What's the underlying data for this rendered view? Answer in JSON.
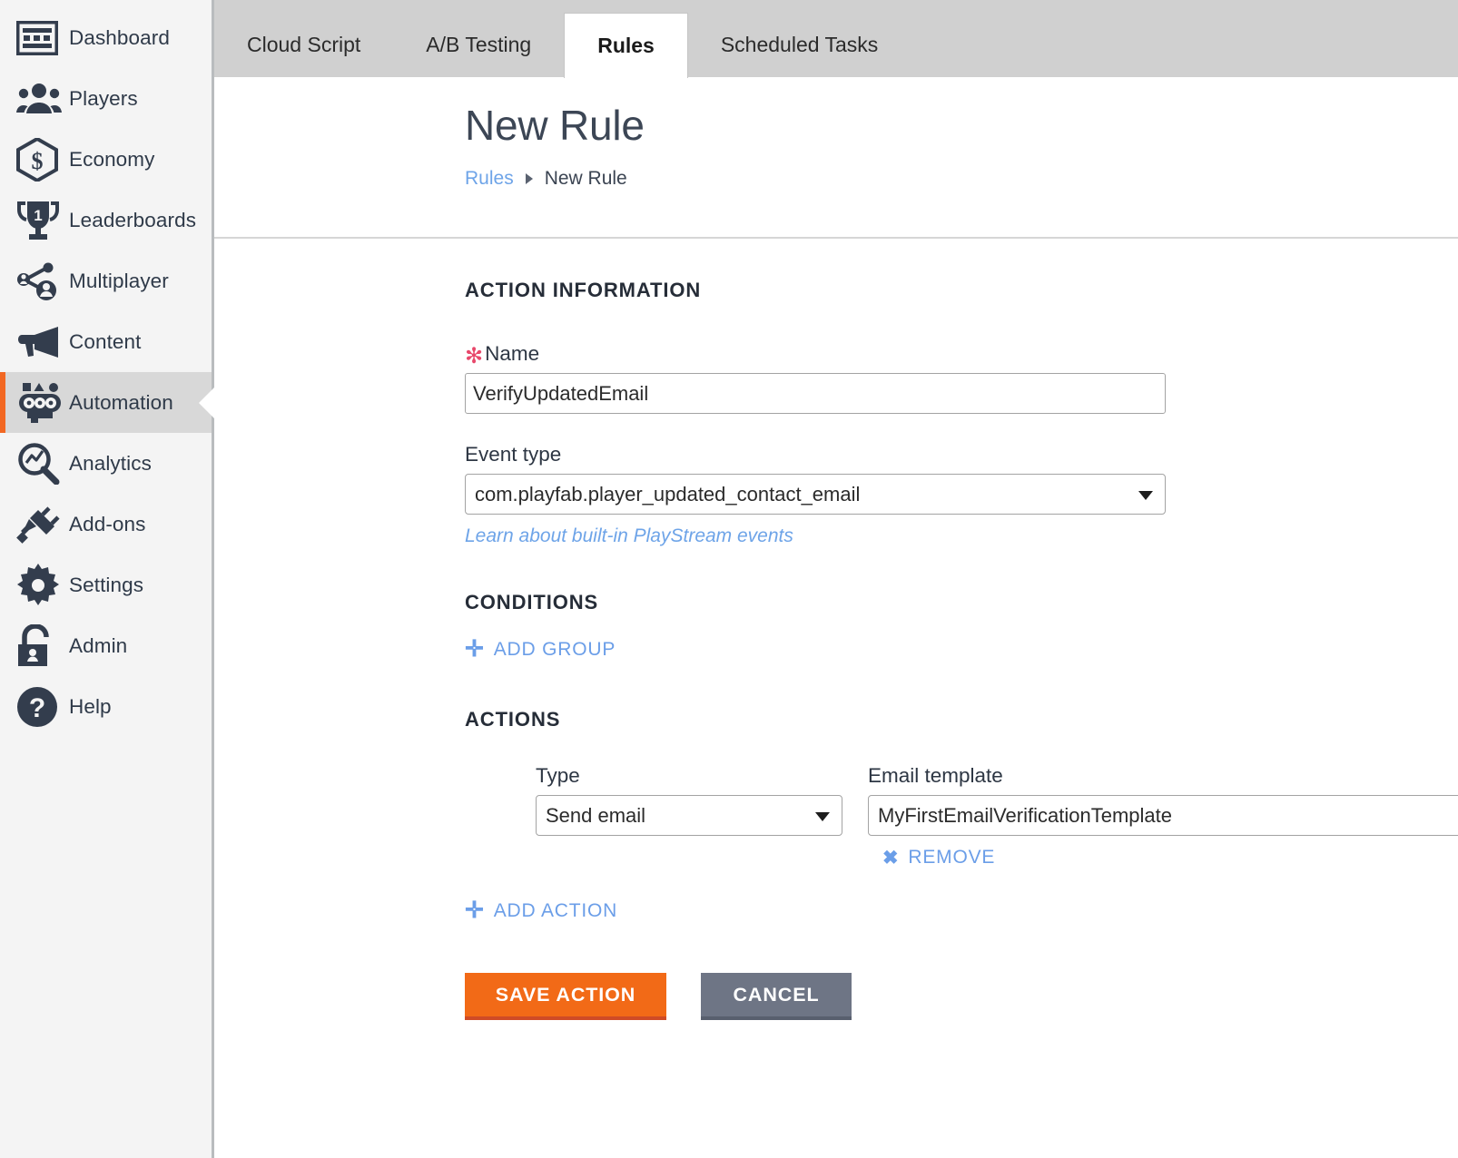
{
  "sidebar": {
    "items": [
      {
        "label": "Dashboard",
        "icon": "dashboard-icon",
        "selected": false
      },
      {
        "label": "Players",
        "icon": "players-icon",
        "selected": false
      },
      {
        "label": "Economy",
        "icon": "economy-icon",
        "selected": false
      },
      {
        "label": "Leaderboards",
        "icon": "leaderboards-icon",
        "selected": false
      },
      {
        "label": "Multiplayer",
        "icon": "multiplayer-icon",
        "selected": false
      },
      {
        "label": "Content",
        "icon": "content-icon",
        "selected": false
      },
      {
        "label": "Automation",
        "icon": "automation-icon",
        "selected": true
      },
      {
        "label": "Analytics",
        "icon": "analytics-icon",
        "selected": false
      },
      {
        "label": "Add-ons",
        "icon": "addons-icon",
        "selected": false
      },
      {
        "label": "Settings",
        "icon": "gear-icon",
        "selected": false
      },
      {
        "label": "Admin",
        "icon": "lock-icon",
        "selected": false
      },
      {
        "label": "Help",
        "icon": "help-icon",
        "selected": false
      }
    ]
  },
  "tabs": [
    {
      "label": "Cloud Script",
      "active": false
    },
    {
      "label": "A/B Testing",
      "active": false
    },
    {
      "label": "Rules",
      "active": true
    },
    {
      "label": "Scheduled Tasks",
      "active": false
    }
  ],
  "page": {
    "title": "New Rule",
    "breadcrumb": {
      "parent": "Rules",
      "current": "New Rule"
    }
  },
  "action_information": {
    "heading": "ACTION INFORMATION",
    "name": {
      "label": "Name",
      "required_marker": "✻",
      "value": "VerifyUpdatedEmail",
      "placeholder": ""
    },
    "event_type": {
      "label": "Event type",
      "value": "com.playfab.player_updated_contact_email"
    },
    "learn_link": "Learn about built-in PlayStream events"
  },
  "conditions": {
    "heading": "CONDITIONS",
    "add_group_label": "ADD GROUP",
    "add_group_glyph": "✛"
  },
  "actions": {
    "heading": "ACTIONS",
    "rows": [
      {
        "type_label": "Type",
        "type_value": "Send email",
        "template_label": "Email template",
        "template_value": "MyFirstEmailVerificationTemplate",
        "remove_label": "REMOVE",
        "remove_glyph": "✖"
      }
    ],
    "add_action_label": "ADD ACTION",
    "add_action_glyph": "✛"
  },
  "footer": {
    "save_label": "SAVE ACTION",
    "cancel_label": "CANCEL"
  },
  "colors": {
    "accent_orange": "#f26a17",
    "link_blue": "#6ea4e8",
    "required_pink": "#e8486b",
    "cancel_gray": "#6e7585",
    "sidebar_bg": "#f4f4f4",
    "sidebar_selected_bg": "#d8d8d8",
    "tabbar_bg": "#d0d0d0"
  }
}
